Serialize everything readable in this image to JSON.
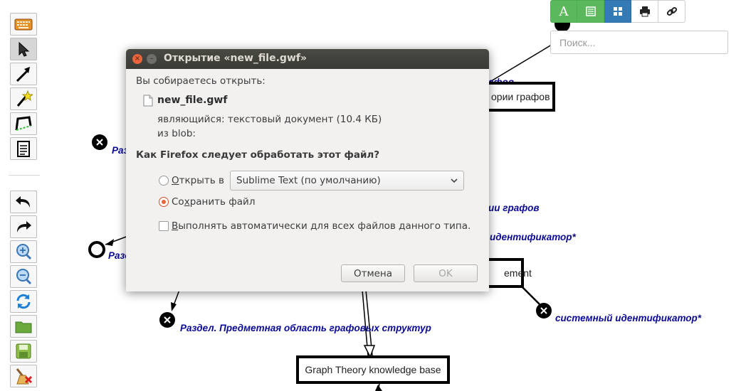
{
  "topbar": {
    "buttons": [
      {
        "name": "text-mode",
        "glyph": "A"
      },
      {
        "name": "list-mode",
        "glyph": "list"
      },
      {
        "name": "grid-mode",
        "glyph": "grid"
      },
      {
        "name": "print",
        "glyph": "print"
      },
      {
        "name": "link",
        "glyph": "link"
      }
    ],
    "search_placeholder": "Поиск..."
  },
  "graph": {
    "labels": {
      "label_top": "афов",
      "label_box_theory": "ории графов",
      "label_razd_1": "Разд",
      "label_theory_2": "ии графов",
      "label_identifier_1": "идентификатор*",
      "label_razd_2": "Разд",
      "label_element": "ement",
      "label_system_id": "системный идентификатор*",
      "label_section_domain": "Раздел. Предметная область графовых структур",
      "label_kb": "Graph Theory knowledge base"
    }
  },
  "dialog": {
    "title": "Открытие «new_file.gwf»",
    "intro": "Вы собираетесь открыть:",
    "filename": "new_file.gwf",
    "type_line": "являющийся: текстовый документ (10.4 КБ)",
    "source_line": "из blob:",
    "question": "Как Firefox следует обработать этот файл?",
    "open_with_label_mn": "О",
    "open_with_label_rest": "ткрыть в",
    "app_select_value": "Sublime Text (по умолчанию)",
    "save_label_pre": "Со",
    "save_label_mn": "х",
    "save_label_rest": "ранить файл",
    "auto_label_mn": "В",
    "auto_label_rest": "ыполнять автоматически для всех файлов данного типа.",
    "cancel_label": "Отмена",
    "ok_label": "OK",
    "selected_action": "save",
    "auto_checked": false
  },
  "colors": {
    "accent_green": "#5cb85c",
    "accent_blue": "#337ab7",
    "label_blue": "#0a0a96",
    "radio_orange": "#e9643a"
  }
}
